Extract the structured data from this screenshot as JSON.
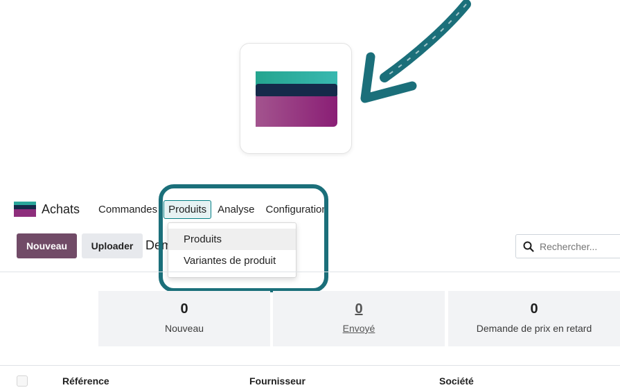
{
  "app": {
    "name": "Achats",
    "brand_colors": {
      "teal": "#2aa79b",
      "navy": "#152a4a",
      "purple": "#8e2e7c"
    }
  },
  "navbar": {
    "items": [
      {
        "label": "Commandes"
      },
      {
        "label": "Produits",
        "active": true
      },
      {
        "label": "Analyse"
      },
      {
        "label": "Configuration"
      }
    ]
  },
  "dropdown": {
    "items": [
      {
        "label": "Produits",
        "hover": true
      },
      {
        "label": "Variantes de produit"
      }
    ]
  },
  "control_panel": {
    "new_label": "Nouveau",
    "upload_label": "Uploader",
    "breadcrumb_partial": "Dem",
    "search_placeholder": "Rechercher..."
  },
  "stats": [
    {
      "value": "0",
      "label": "Nouveau"
    },
    {
      "value": "0",
      "label": "Envoyé",
      "linked": true
    },
    {
      "value": "0",
      "label": "Demande de prix en retard"
    }
  ],
  "table": {
    "columns": [
      "Référence",
      "Fournisseur",
      "Société"
    ]
  },
  "icons": {
    "arrow": "hand-drawn-arrow-icon",
    "app": "purchase-app-icon",
    "search": "search-icon"
  }
}
